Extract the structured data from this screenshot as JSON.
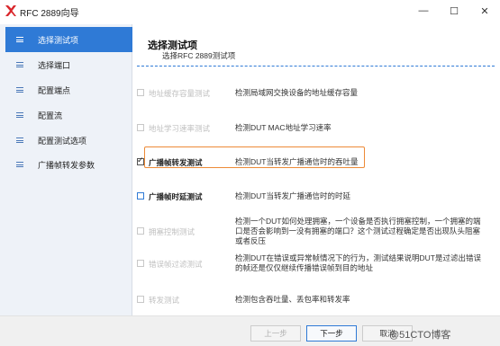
{
  "window": {
    "title": "RFC 2889向导",
    "logo_icon": "red-x-logo",
    "minimize_glyph": "—",
    "maximize_glyph": "☐",
    "close_glyph": "✕"
  },
  "sidebar": {
    "items": [
      {
        "label": "选择测试项",
        "active": true
      },
      {
        "label": "选择端口",
        "active": false
      },
      {
        "label": "配置端点",
        "active": false
      },
      {
        "label": "配置流",
        "active": false
      },
      {
        "label": "配置测试选项",
        "active": false
      },
      {
        "label": "广播帧转发参数",
        "active": false
      }
    ]
  },
  "header": {
    "title": "选择测试项",
    "subtitle": "选择RFC 2889测试项"
  },
  "tests": [
    {
      "label": "地址缓存容量测试",
      "description": "检测局域网交换设备的地址缓存容量",
      "checked": false,
      "enabled": false
    },
    {
      "label": "地址学习速率测试",
      "description": "检测DUT MAC地址学习速率",
      "checked": false,
      "enabled": false
    },
    {
      "label": "广播帧转发测试",
      "description": "检测DUT当转发广播通信时的吞吐量",
      "checked": true,
      "enabled": true
    },
    {
      "label": "广播帧时延测试",
      "description": "检测DUT当转发广播通信时的时延",
      "checked": false,
      "enabled": true
    },
    {
      "label": "拥塞控制测试",
      "description": "检测一个DUT如何处理拥塞，一个设备是否执行拥塞控制，一个拥塞的端口是否会影响到一没有拥塞的端口？这个测试过程确定是否出现队头阻塞或者反压",
      "checked": false,
      "enabled": false
    },
    {
      "label": "错误帧过滤测试",
      "description": "检测DUT在错误或异常帧情况下的行为，测试结果说明DUT是过滤出错误的帧还是仅仅继续传播错误帧到目的地址",
      "checked": false,
      "enabled": false
    },
    {
      "label": "转发测试",
      "description": "检测包含吞吐量、丢包率和转发率",
      "checked": false,
      "enabled": false
    }
  ],
  "footer": {
    "prev_label": "上一步",
    "next_label": "下一步",
    "cancel_label": "取消"
  },
  "watermark": "@51CTO博客",
  "colors": {
    "accent": "#2f7ad6",
    "highlight": "#ed8a37",
    "sidebar_bg": "#eef2f8"
  }
}
